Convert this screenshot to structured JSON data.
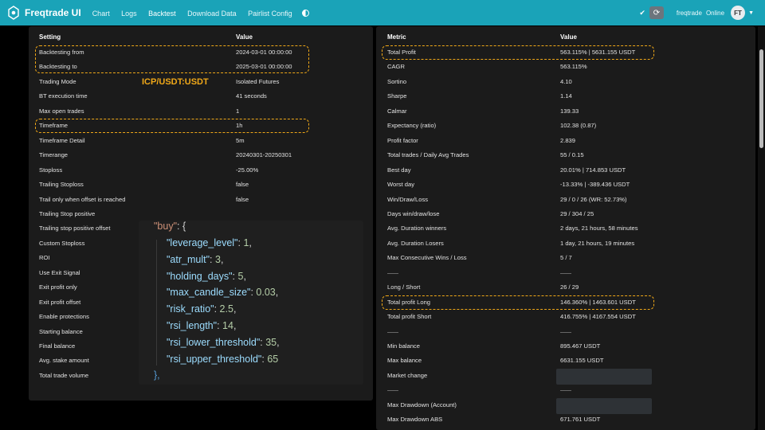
{
  "app": {
    "title": "Freqtrade UI",
    "nav": [
      "Chart",
      "Logs",
      "Backtest",
      "Download Data",
      "Pairlist Config"
    ],
    "user": "freqtrade",
    "status": "Online",
    "avatar": "FT"
  },
  "left_table": {
    "headers": [
      "Setting",
      "Value"
    ],
    "rows": [
      [
        "Backtesting from",
        "2024-03-01 00:00:00"
      ],
      [
        "Backtesting to",
        "2025-03-01 00:00:00"
      ],
      [
        "Trading Mode",
        "Isolated Futures"
      ],
      [
        "BT execution time",
        "41 seconds"
      ],
      [
        "Max open trades",
        "1"
      ],
      [
        "Timeframe",
        "1h"
      ],
      [
        "Timeframe Detail",
        "5m"
      ],
      [
        "Timerange",
        "20240301-20250301"
      ],
      [
        "Stoploss",
        "-25.00%"
      ],
      [
        "Trailing Stoploss",
        "false"
      ],
      [
        "Trail only when offset is reached",
        "false"
      ],
      [
        "Trailing Stop positive",
        ""
      ],
      [
        "Trailing stop positive offset",
        ""
      ],
      [
        "Custom Stoploss",
        ""
      ],
      [
        "ROI",
        ""
      ],
      [
        "Use Exit Signal",
        ""
      ],
      [
        "Exit profit only",
        ""
      ],
      [
        "Exit profit offset",
        ""
      ],
      [
        "Enable protections",
        ""
      ],
      [
        "Starting balance",
        ""
      ],
      [
        "Final balance",
        ""
      ],
      [
        "Avg. stake amount",
        ""
      ],
      [
        "Total trade volume",
        ""
      ]
    ]
  },
  "overlay_label": "ICP/USDT:USDT",
  "code": {
    "line0_key": "\"buy\"",
    "line0_rest": ": {",
    "params": [
      {
        "key": "\"leverage_level\"",
        "value": "1"
      },
      {
        "key": "\"atr_mult\"",
        "value": "3"
      },
      {
        "key": "\"holding_days\"",
        "value": "5"
      },
      {
        "key": "\"max_candle_size\"",
        "value": "0.03"
      },
      {
        "key": "\"risk_ratio\"",
        "value": "2.5"
      },
      {
        "key": "\"rsi_length\"",
        "value": "14"
      },
      {
        "key": "\"rsi_lower_threshold\"",
        "value": "35"
      },
      {
        "key": "\"rsi_upper_threshold\"",
        "value": "65"
      }
    ],
    "closing": "},"
  },
  "right_table": {
    "headers": [
      "Metric",
      "Value"
    ],
    "rows": [
      [
        "Total Profit",
        "563.115% | 5631.155 USDT"
      ],
      [
        "CAGR",
        "563.115%"
      ],
      [
        "Sortino",
        "4.10"
      ],
      [
        "Sharpe",
        "1.14"
      ],
      [
        "Calmar",
        "139.33"
      ],
      [
        "Expectancy (ratio)",
        "102.38 (0.87)"
      ],
      [
        "Profit factor",
        "2.839"
      ],
      [
        "Total trades / Daily Avg Trades",
        "55 / 0.15"
      ],
      [
        "Best day",
        "20.01% | 714.853 USDT"
      ],
      [
        "Worst day",
        "-13.33% | -389.436 USDT"
      ],
      [
        "Win/Draw/Loss",
        "29 / 0 / 26 (WR: 52.73%)"
      ],
      [
        "Days win/draw/lose",
        "29 / 304 / 25"
      ],
      [
        "Avg. Duration winners",
        "2 days, 21 hours, 58 minutes"
      ],
      [
        "Avg. Duration Losers",
        "1 day, 21 hours, 19 minutes"
      ],
      [
        "Max Consecutive Wins / Loss",
        "5 / 7"
      ],
      [
        "",
        ""
      ],
      [
        "Long / Short",
        "26 / 29"
      ],
      [
        "Total profit Long",
        "146.360% | 1463.601 USDT"
      ],
      [
        "Total profit Short",
        "416.755% | 4167.554 USDT"
      ],
      [
        "",
        ""
      ],
      [
        "Min balance",
        "895.467 USDT"
      ],
      [
        "Max balance",
        "6631.155 USDT"
      ],
      [
        "Market change",
        ""
      ],
      [
        "",
        ""
      ],
      [
        "Max Drawdown (Account)",
        ""
      ],
      [
        "Max Drawdown ABS",
        "671.761 USDT"
      ]
    ]
  },
  "colors": {
    "navbar": "#1aa3b8",
    "highlight": "#f0a818",
    "panel": "#1b1b1b"
  }
}
